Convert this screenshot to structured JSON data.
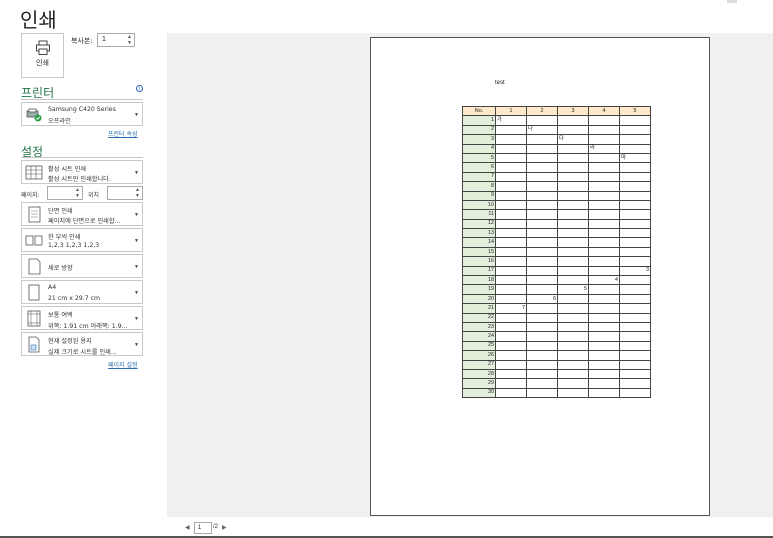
{
  "title": "인쇄",
  "print_button": {
    "label": "인쇄"
  },
  "copies": {
    "label": "복사본:",
    "value": "1"
  },
  "printer": {
    "heading": "프린터",
    "name": "Samsung C420 Series",
    "status": "오프라인",
    "properties_link": "프린터 속성"
  },
  "settings": {
    "heading": "설정",
    "items": [
      {
        "line1": "활성 시트 인쇄",
        "line2": "활성 시트만 인쇄합니다."
      },
      {
        "line1": "단면 인쇄",
        "line2": "페이지에 단면으로 인쇄합..."
      },
      {
        "line1": "한 부씩 인쇄",
        "line2": "1,2,3    1,2,3    1,2,3"
      },
      {
        "line1": "세로 방향",
        "line2": ""
      },
      {
        "line1": "A4",
        "line2": "21 cm x 29.7 cm"
      },
      {
        "line1": "보통 여백",
        "line2": "위쪽: 1.91 cm 아래쪽: 1.9..."
      },
      {
        "line1": "현재 설정된 용지",
        "line2": "실제 크기로 시트를 인쇄..."
      }
    ],
    "pages_label": "페이지:",
    "to_label": "위치",
    "page_setup_link": "페이지 설정"
  },
  "preview": {
    "sheet_title": "test",
    "header": [
      "No.",
      "1",
      "2",
      "3",
      "4",
      "5"
    ],
    "rows": [
      [
        "1",
        "가",
        "",
        "",
        "",
        ""
      ],
      [
        "2",
        "",
        "나",
        "",
        "",
        ""
      ],
      [
        "3",
        "",
        "",
        "다",
        "",
        ""
      ],
      [
        "4",
        "",
        "",
        "",
        "라",
        ""
      ],
      [
        "5",
        "",
        "",
        "",
        "",
        "마"
      ],
      [
        "6",
        "",
        "",
        "",
        "",
        ""
      ],
      [
        "7",
        "",
        "",
        "",
        "",
        ""
      ],
      [
        "8",
        "",
        "",
        "",
        "",
        ""
      ],
      [
        "9",
        "",
        "",
        "",
        "",
        ""
      ],
      [
        "10",
        "",
        "",
        "",
        "",
        ""
      ],
      [
        "11",
        "",
        "",
        "",
        "",
        ""
      ],
      [
        "12",
        "",
        "",
        "",
        "",
        ""
      ],
      [
        "13",
        "",
        "",
        "",
        "",
        ""
      ],
      [
        "14",
        "",
        "",
        "",
        "",
        ""
      ],
      [
        "15",
        "",
        "",
        "",
        "",
        ""
      ],
      [
        "16",
        "",
        "",
        "",
        "",
        ""
      ],
      [
        "17",
        "",
        "",
        "",
        "",
        "3"
      ],
      [
        "18",
        "",
        "",
        "",
        "4",
        ""
      ],
      [
        "19",
        "",
        "",
        "5",
        "",
        ""
      ],
      [
        "20",
        "",
        "6",
        "",
        "",
        ""
      ],
      [
        "21",
        "7",
        "",
        "",
        "",
        ""
      ],
      [
        "22",
        "",
        "",
        "",
        "",
        ""
      ],
      [
        "23",
        "",
        "",
        "",
        "",
        ""
      ],
      [
        "24",
        "",
        "",
        "",
        "",
        ""
      ],
      [
        "25",
        "",
        "",
        "",
        "",
        ""
      ],
      [
        "26",
        "",
        "",
        "",
        "",
        ""
      ],
      [
        "27",
        "",
        "",
        "",
        "",
        ""
      ],
      [
        "28",
        "",
        "",
        "",
        "",
        ""
      ],
      [
        "29",
        "",
        "",
        "",
        "",
        ""
      ],
      [
        "30",
        "",
        "",
        "",
        "",
        ""
      ]
    ]
  },
  "page_nav": {
    "current": "1",
    "total": "/2"
  },
  "colors": {
    "accent": "#217346",
    "link": "#2a6fb3",
    "header_fill": "#fde9c9",
    "rowhead_fill": "#e2efda"
  },
  "icons": [
    "printer-icon",
    "printer-device-icon",
    "sheets-icon",
    "single-sided-icon",
    "collate-icon",
    "portrait-icon",
    "paper-size-icon",
    "margins-icon",
    "scaling-icon",
    "info-icon"
  ]
}
